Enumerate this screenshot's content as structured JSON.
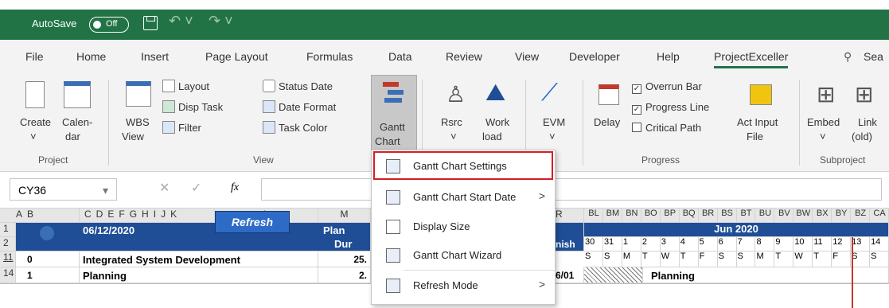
{
  "window": {
    "autosave_label": "AutoSave",
    "autosave_state": "Off"
  },
  "menu": [
    "File",
    "Home",
    "Insert",
    "Page Layout",
    "Formulas",
    "Data",
    "Review",
    "View",
    "Developer",
    "Help",
    "ProjectExceller",
    "Sea"
  ],
  "ribbon": {
    "project": {
      "create": "Create",
      "calendar1": "Calen-",
      "calendar2": "dar",
      "group": "Project"
    },
    "view": {
      "wbs1": "WBS",
      "wbs2": "View",
      "layout": "Layout",
      "disp_task": "Disp Task",
      "filter": "Filter",
      "status_date": "Status Date",
      "date_format": "Date Format",
      "task_color": "Task Color",
      "group": "View"
    },
    "gantt": {
      "line1": "Gantt",
      "line2": "Chart"
    },
    "rsrc": {
      "rsrc": "Rsrc",
      "work1": "Work",
      "work2": "load"
    },
    "evm": "EVM",
    "progress": {
      "delay": "Delay",
      "overrun": "Overrun Bar",
      "progress_line": "Progress Line",
      "critical_path": "Critical Path",
      "act_input1": "Act Input",
      "act_input2": "File",
      "group": "Progress"
    },
    "subproject": {
      "embed": "Embed",
      "link1": "Link",
      "link2": "(old)",
      "group": "Subproject"
    }
  },
  "formula": {
    "namebox": "CY36",
    "fx": "fx"
  },
  "dropdown": [
    "Gantt Chart Settings",
    "Gantt Chart Start Date",
    "Display Size",
    "Gantt Chart Wizard",
    "Refresh Mode"
  ],
  "grid": {
    "col_headers_left": [
      "A",
      "B",
      "C",
      "D",
      "E",
      "F",
      "G",
      "H",
      "I",
      "J",
      "K",
      "L",
      "M"
    ],
    "col_R": "R",
    "date_cols": [
      "BL",
      "BM",
      "BN",
      "BO",
      "BP",
      "BQ",
      "BR",
      "BS",
      "BT",
      "BU",
      "BV",
      "BW",
      "BX",
      "BY",
      "BZ",
      "CA"
    ],
    "rows": [
      "1",
      "2",
      "11",
      "14"
    ],
    "status_date": "06/12/2020",
    "refresh": "Refresh",
    "plan1": "Plan",
    "plan2": "Dur",
    "finish_fragment": "nish",
    "month": "Jun 2020",
    "days": [
      "30",
      "31",
      "1",
      "2",
      "3",
      "4",
      "5",
      "6",
      "7",
      "8",
      "9",
      "10",
      "11",
      "12",
      "13",
      "14"
    ],
    "weekdays": [
      "S",
      "S",
      "M",
      "T",
      "W",
      "T",
      "F",
      "S",
      "S",
      "M",
      "T",
      "W",
      "T",
      "F",
      "S",
      "S"
    ],
    "row11": {
      "num": "0",
      "name": "Integrated System Development",
      "dur": "25."
    },
    "row14": {
      "num": "1",
      "name": "Planning",
      "dur": "2.",
      "finish": "6/01",
      "bar_label": "Planning"
    }
  }
}
